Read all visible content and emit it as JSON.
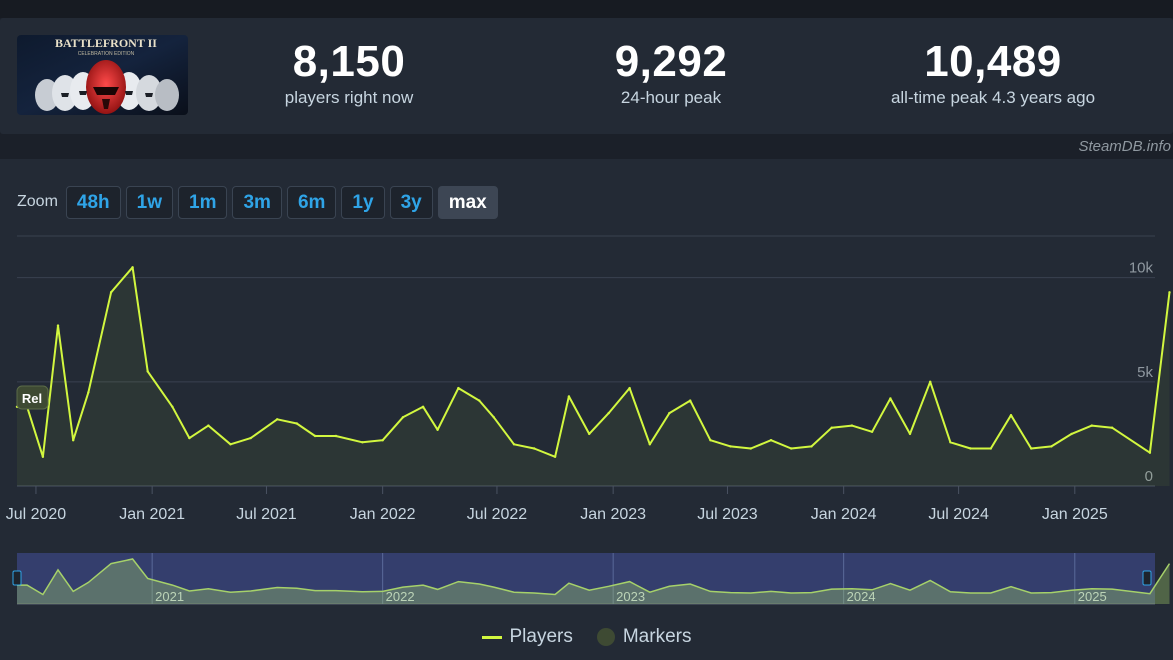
{
  "stats": {
    "current": {
      "value": "8,150",
      "label": "players right now"
    },
    "peak24h": {
      "value": "9,292",
      "label": "24-hour peak"
    },
    "alltime": {
      "value": "10,489",
      "label": "all-time peak 4.3 years ago"
    }
  },
  "game_image_icon": "star-wars-battlefront-ii-capsule",
  "attribution": "SteamDB.info",
  "zoom": {
    "label": "Zoom",
    "options": [
      "48h",
      "1w",
      "1m",
      "3m",
      "6m",
      "1y",
      "3y",
      "max"
    ],
    "active": "max"
  },
  "colors": {
    "line": "#d2f73f",
    "accent": "#2fa4e7",
    "navigator_bg": "#3b4680",
    "navigator_line": "#a6d16a",
    "marker": "#3e4a33"
  },
  "marker": {
    "label": "Rel",
    "date": "2020-05-31"
  },
  "legend": {
    "players": "Players",
    "markers": "Markers"
  },
  "chart_data": {
    "type": "line",
    "title": "",
    "xlabel": "",
    "ylabel": "",
    "ylim": [
      0,
      10000
    ],
    "y_ticks": [
      {
        "value": 0,
        "label": "0"
      },
      {
        "value": 5000,
        "label": "5k"
      },
      {
        "value": 10000,
        "label": "10k"
      }
    ],
    "x_ticks": [
      {
        "date": "2020-07-01",
        "label": "Jul 2020"
      },
      {
        "date": "2021-01-01",
        "label": "Jan 2021"
      },
      {
        "date": "2021-07-01",
        "label": "Jul 2021"
      },
      {
        "date": "2022-01-01",
        "label": "Jan 2022"
      },
      {
        "date": "2022-07-01",
        "label": "Jul 2022"
      },
      {
        "date": "2023-01-01",
        "label": "Jan 2023"
      },
      {
        "date": "2023-07-01",
        "label": "Jul 2023"
      },
      {
        "date": "2024-01-01",
        "label": "Jan 2024"
      },
      {
        "date": "2024-07-01",
        "label": "Jul 2024"
      },
      {
        "date": "2025-01-01",
        "label": "Jan 2025"
      }
    ],
    "navigator_labels": [
      {
        "date": "2021-01-01",
        "label": "2021"
      },
      {
        "date": "2022-01-01",
        "label": "2022"
      },
      {
        "date": "2023-01-01",
        "label": "2023"
      },
      {
        "date": "2024-01-01",
        "label": "2024"
      },
      {
        "date": "2025-01-01",
        "label": "2025"
      }
    ],
    "x_range": [
      "2020-06-01",
      "2025-05-08"
    ],
    "series": [
      {
        "name": "Players",
        "points": [
          [
            "2020-06-01",
            3800
          ],
          [
            "2020-06-17",
            3800
          ],
          [
            "2020-07-12",
            1400
          ],
          [
            "2020-08-05",
            7700
          ],
          [
            "2020-08-29",
            2200
          ],
          [
            "2020-09-22",
            4500
          ],
          [
            "2020-10-28",
            9300
          ],
          [
            "2020-12-01",
            10500
          ],
          [
            "2020-12-25",
            5500
          ],
          [
            "2021-02-02",
            3800
          ],
          [
            "2021-03-01",
            2300
          ],
          [
            "2021-03-31",
            2900
          ],
          [
            "2021-05-05",
            2000
          ],
          [
            "2021-06-06",
            2300
          ],
          [
            "2021-07-18",
            3200
          ],
          [
            "2021-08-18",
            3000
          ],
          [
            "2021-09-16",
            2400
          ],
          [
            "2021-10-19",
            2400
          ],
          [
            "2021-11-30",
            2100
          ],
          [
            "2022-01-01",
            2200
          ],
          [
            "2022-02-02",
            3300
          ],
          [
            "2022-03-06",
            3800
          ],
          [
            "2022-03-29",
            2700
          ],
          [
            "2022-05-01",
            4700
          ],
          [
            "2022-06-03",
            4100
          ],
          [
            "2022-06-26",
            3300
          ],
          [
            "2022-07-28",
            2000
          ],
          [
            "2022-08-29",
            1800
          ],
          [
            "2022-10-01",
            1400
          ],
          [
            "2022-10-23",
            4300
          ],
          [
            "2022-11-24",
            2500
          ],
          [
            "2022-12-25",
            3500
          ],
          [
            "2023-01-27",
            4700
          ],
          [
            "2023-02-28",
            2000
          ],
          [
            "2023-03-31",
            3500
          ],
          [
            "2023-05-03",
            4100
          ],
          [
            "2023-06-04",
            2200
          ],
          [
            "2023-07-06",
            1900
          ],
          [
            "2023-08-07",
            1800
          ],
          [
            "2023-09-08",
            2200
          ],
          [
            "2023-10-10",
            1800
          ],
          [
            "2023-11-11",
            1900
          ],
          [
            "2023-12-13",
            2800
          ],
          [
            "2024-01-14",
            2900
          ],
          [
            "2024-02-15",
            2600
          ],
          [
            "2024-03-15",
            4200
          ],
          [
            "2024-04-15",
            2500
          ],
          [
            "2024-05-17",
            5000
          ],
          [
            "2024-06-18",
            2100
          ],
          [
            "2024-07-20",
            1800
          ],
          [
            "2024-08-21",
            1800
          ],
          [
            "2024-09-22",
            3400
          ],
          [
            "2024-10-24",
            1800
          ],
          [
            "2024-11-25",
            1900
          ],
          [
            "2024-12-27",
            2500
          ],
          [
            "2025-01-28",
            2900
          ],
          [
            "2025-03-01",
            2800
          ],
          [
            "2025-04-30",
            1600
          ],
          [
            "2025-05-31",
            9300
          ]
        ]
      }
    ]
  }
}
